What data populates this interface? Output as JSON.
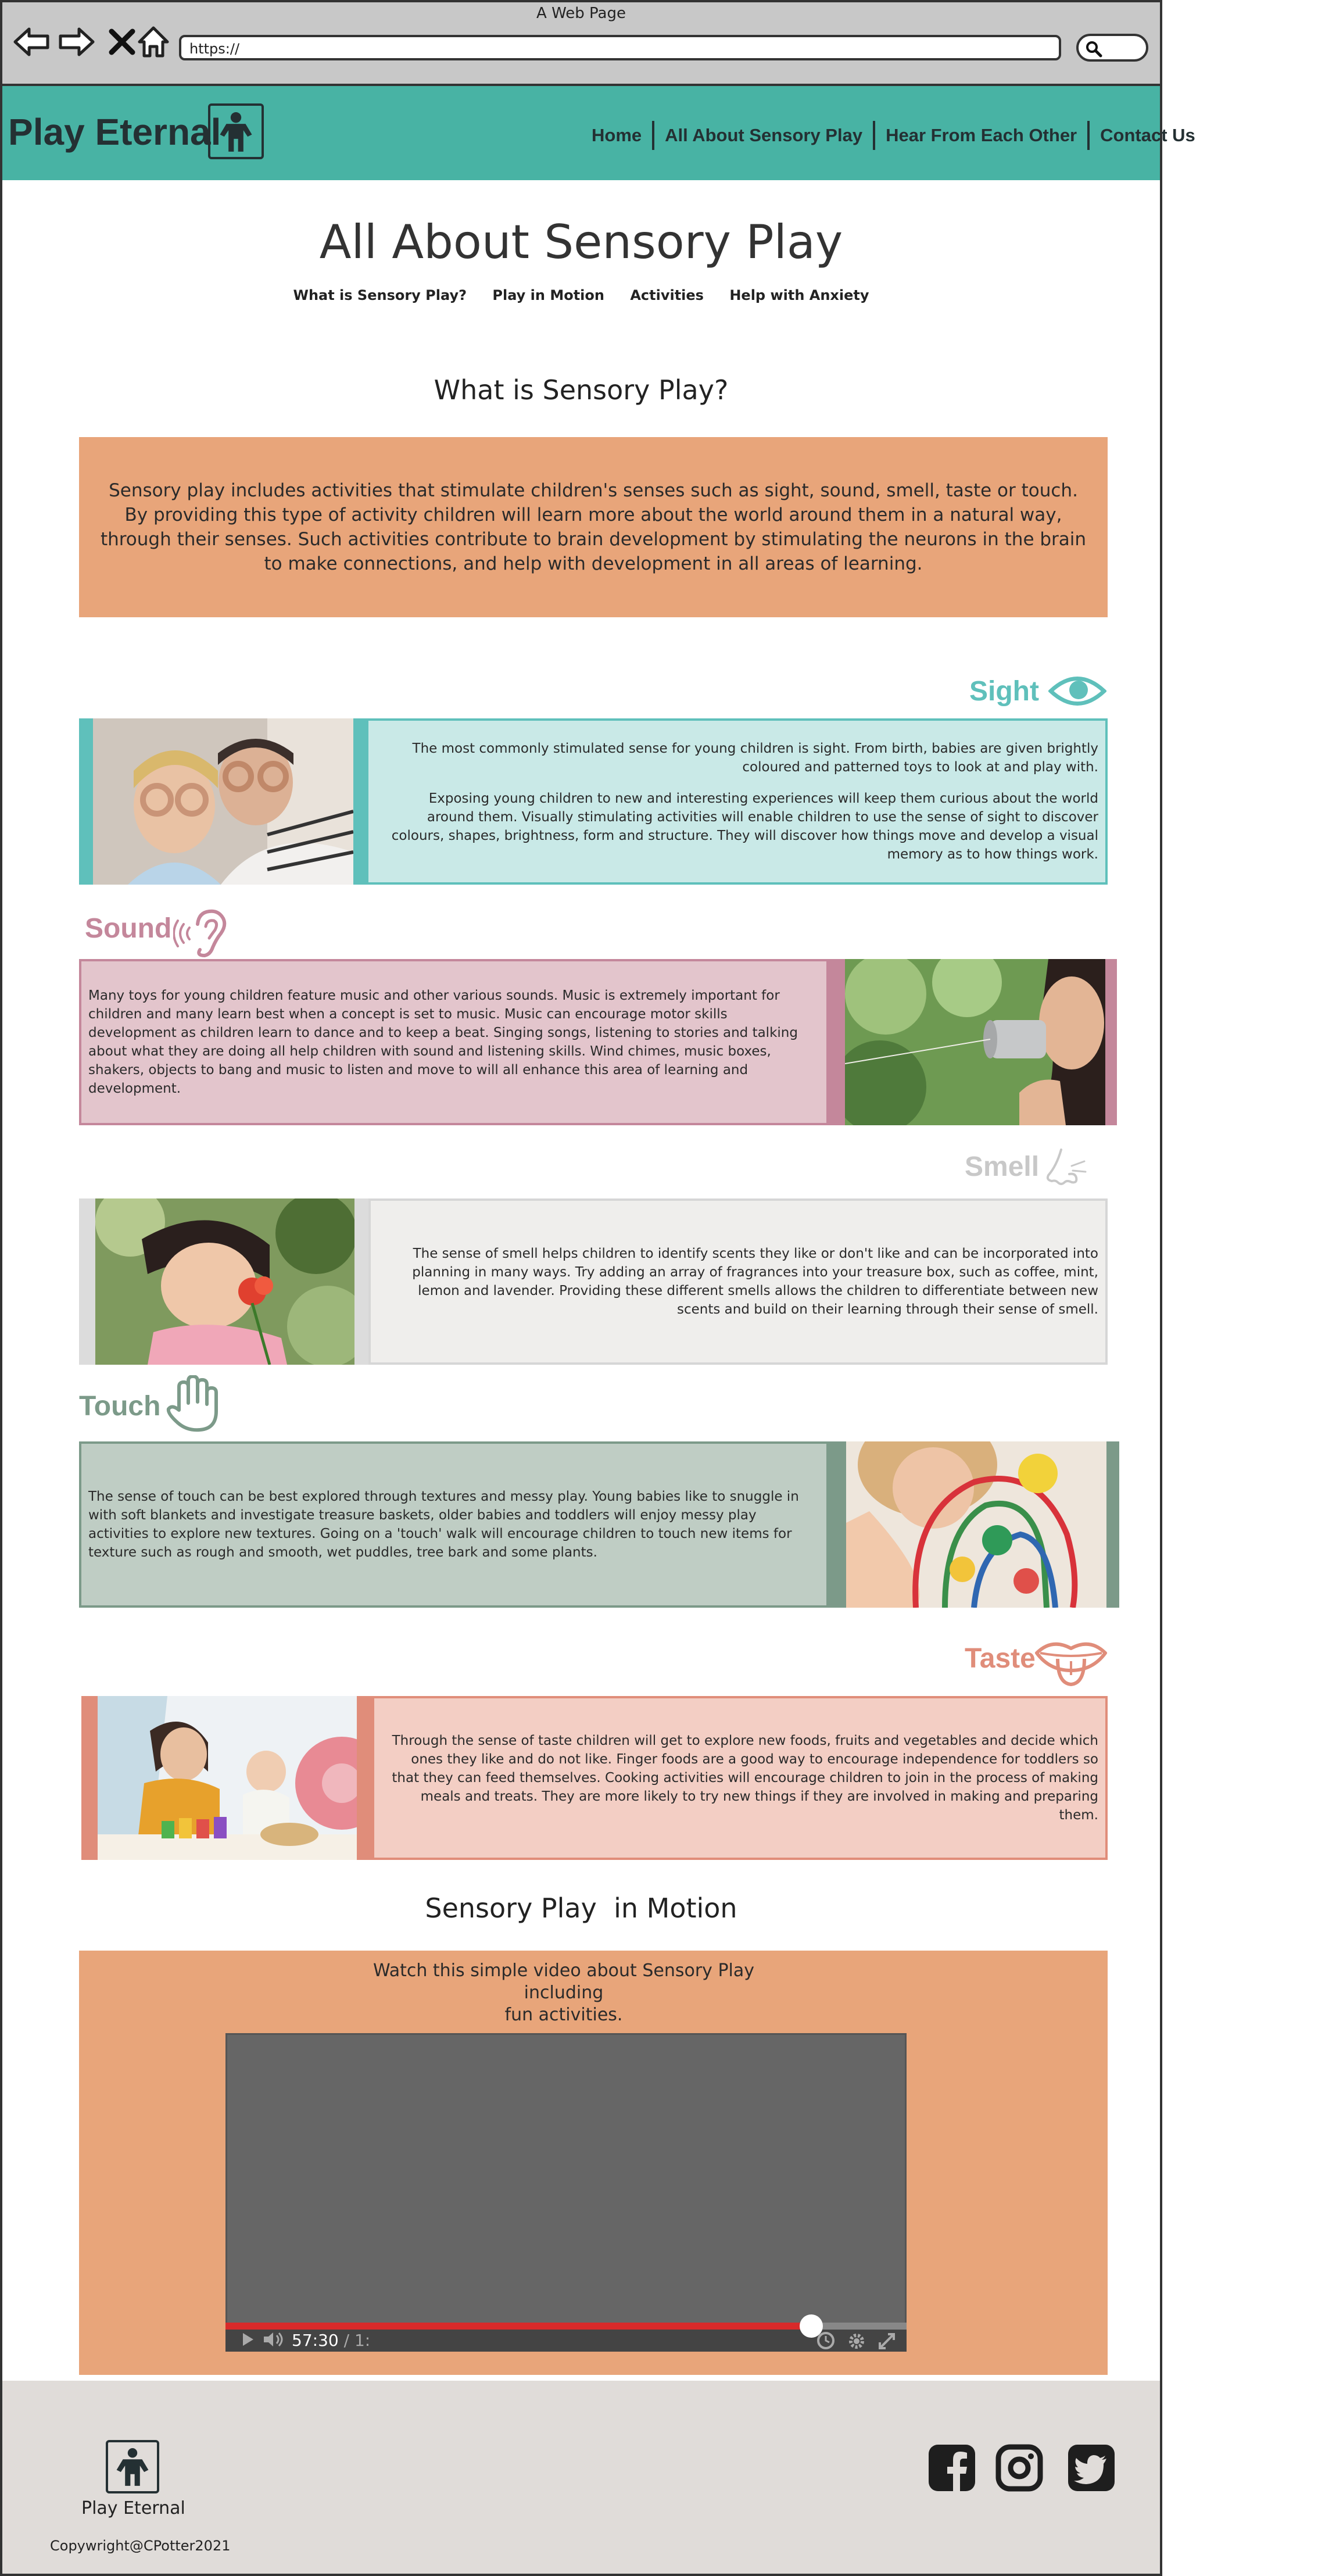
{
  "browser": {
    "window_title": "A Web Page",
    "url": "https://"
  },
  "header": {
    "brand": "Play Eternal",
    "nav": [
      "Home",
      "All About Sensory Play",
      "Hear From Each Other",
      "Contact Us"
    ]
  },
  "page": {
    "title": "All About Sensory Play",
    "subnav": [
      "What is Sensory Play?",
      "Play in Motion",
      "Activities",
      "Help with Anxiety"
    ]
  },
  "intro": {
    "heading": "What is Sensory Play?",
    "text": "Sensory play includes activities that stimulate children's senses such as sight, sound, smell, taste or touch. By providing this type of activity children will learn more about the world around them in a natural way, through their senses. Such activities contribute to brain development by stimulating the neurons in the brain to make connections, and help with development in all areas of learning."
  },
  "senses": {
    "sight": {
      "label": "Sight",
      "p1": "The most commonly stimulated sense for young children is sight. From birth, babies are given brightly coloured and patterned toys to look at and play with.",
      "p2": "Exposing young children to new and interesting experiences will keep them curious about the world around them. Visually stimulating activities will enable children to use the sense of sight to discover colours, shapes, brightness, form and structure. They will discover how things move and develop a visual memory as to how things work.",
      "color": "#5fc0bb"
    },
    "sound": {
      "label": "Sound",
      "p1": "Many toys for young children feature music and other various sounds. Music is extremely important for children and many learn best when a concept is set to music. Music can encourage motor skills development as children learn to dance and to keep a beat. Singing songs, listening to stories and talking about what they are doing all help children with sound and listening skills. Wind chimes, music boxes, shakers, objects to bang and music to listen and move to will all enhance this area of learning and development.",
      "color": "#c4879b"
    },
    "smell": {
      "label": "Smell",
      "p1": "The sense of smell helps children to identify scents they like or don't like and can be incorporated into planning in many ways. Try adding an array of fragrances into your treasure box, such as coffee, mint, lemon and lavender. Providing these different smells allows the children to differentiate between new scents and build on their learning through their sense of smell.",
      "color": "#cfcfcf"
    },
    "touch": {
      "label": "Touch",
      "p1": "The sense of touch can be best explored through textures and messy play. Young babies like to snuggle in with soft blankets and investigate treasure baskets, older babies and toddlers will enjoy messy play activities to explore new textures. Going on a 'touch' walk will encourage children to touch new items for texture such as rough and smooth, wet puddles, tree bark and some plants.",
      "color": "#7c9a89"
    },
    "taste": {
      "label": "Taste",
      "p1": "Through the sense of taste children will get to explore new foods, fruits and vegetables and decide which ones they like and do not like. Finger foods are a good way to encourage independence for toddlers so that they can feed themselves. Cooking activities will encourage children to join in the process of making meals and treats. They are more likely to try new things if they are involved in making and preparing them.",
      "color": "#e08d7a"
    }
  },
  "motion": {
    "heading": "Sensory Play  in Motion",
    "caption_1": "Watch this simple video about Sensory Play",
    "caption_2": "including",
    "caption_3": "fun activities.",
    "video_time": "57:30",
    "video_total": "/ 1:",
    "progress": 0.86
  },
  "footer": {
    "brand": "Play Eternal",
    "copyright": "Copywright@CPotter2021",
    "social_icons": [
      "facebook-icon",
      "instagram-icon",
      "twitter-icon"
    ]
  }
}
